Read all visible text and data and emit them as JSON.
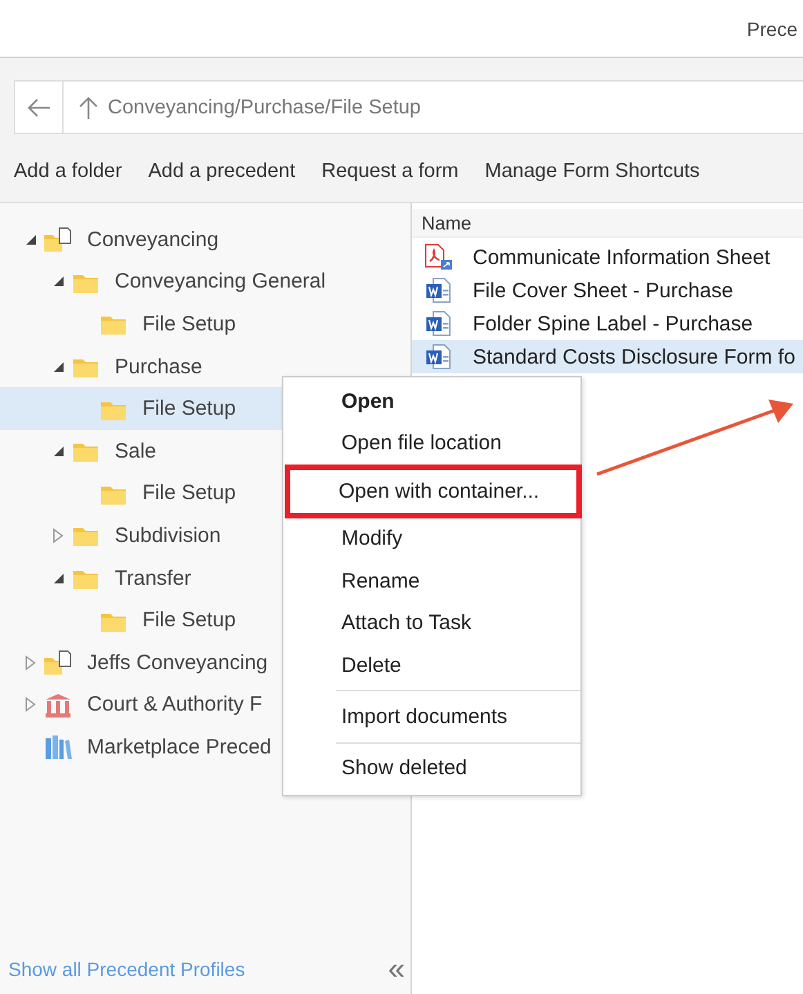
{
  "header": {
    "title": "Prece"
  },
  "address_bar": {
    "path": "Conveyancing/Purchase/File Setup"
  },
  "toolbar": [
    "Add a folder",
    "Add a precedent",
    "Request a form",
    "Manage Form Shortcuts"
  ],
  "tree": [
    {
      "label": "Conveyancing",
      "kind": "profile",
      "expanded": true,
      "selected": false,
      "children": [
        {
          "label": "Conveyancing General",
          "kind": "folder",
          "expanded": true,
          "selected": false,
          "children": [
            {
              "label": "File Setup",
              "kind": "folder",
              "selected": false
            }
          ]
        },
        {
          "label": "Purchase",
          "kind": "folder",
          "expanded": true,
          "selected": false,
          "children": [
            {
              "label": "File Setup",
              "kind": "folder",
              "selected": true
            }
          ]
        },
        {
          "label": "Sale",
          "kind": "folder",
          "expanded": true,
          "selected": false,
          "children": [
            {
              "label": "File Setup",
              "kind": "folder",
              "selected": false
            }
          ]
        },
        {
          "label": "Subdivision",
          "kind": "folder",
          "expanded": false,
          "selected": false
        },
        {
          "label": "Transfer",
          "kind": "folder",
          "expanded": true,
          "selected": false,
          "children": [
            {
              "label": "File Setup",
              "kind": "folder",
              "selected": false
            }
          ]
        }
      ]
    },
    {
      "label": "Jeffs Conveyancing",
      "kind": "profile",
      "expanded": false,
      "selected": false
    },
    {
      "label": "Court & Authority F",
      "kind": "court",
      "expanded": false,
      "selected": false
    },
    {
      "label": "Marketplace Preced",
      "kind": "marketplace",
      "selected": false
    }
  ],
  "footer": {
    "link": "Show all Precedent Profiles",
    "collapse": "«"
  },
  "files": {
    "columns": [
      "Name"
    ],
    "rows": [
      {
        "name": "Communicate Information Sheet",
        "kind": "pdf",
        "selected": false
      },
      {
        "name": "File Cover Sheet - Purchase",
        "kind": "word",
        "selected": false
      },
      {
        "name": "Folder Spine Label - Purchase",
        "kind": "word",
        "selected": false
      },
      {
        "name": "Standard Costs Disclosure Form fo",
        "kind": "word",
        "selected": true
      }
    ]
  },
  "context_menu": [
    {
      "kind": "item",
      "label": "Open",
      "default": true,
      "highlighted": false
    },
    {
      "kind": "item",
      "label": "Open file location",
      "default": false,
      "highlighted": false
    },
    {
      "kind": "item",
      "label": "Open with container...",
      "default": false,
      "highlighted": true
    },
    {
      "kind": "item",
      "label": "Modify",
      "default": false,
      "highlighted": false
    },
    {
      "kind": "item",
      "label": "Rename",
      "default": false,
      "highlighted": false
    },
    {
      "kind": "item",
      "label": "Attach to Task",
      "default": false,
      "highlighted": false
    },
    {
      "kind": "item",
      "label": "Delete",
      "default": false,
      "highlighted": false
    },
    {
      "kind": "separator"
    },
    {
      "kind": "item",
      "label": "Import documents",
      "default": false,
      "highlighted": false
    },
    {
      "kind": "separator"
    },
    {
      "kind": "item",
      "label": "Show deleted",
      "default": false,
      "highlighted": false
    }
  ]
}
